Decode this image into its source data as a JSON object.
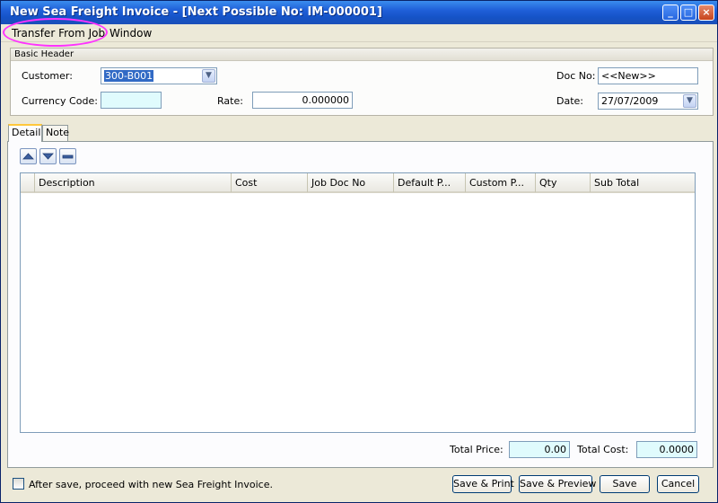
{
  "window": {
    "title": "New Sea Freight Invoice  - [Next Possible No: IM-000001]",
    "minimize": "_",
    "maximize": "□",
    "close": "×"
  },
  "menu": {
    "transfer_from_job": "Transfer From Job",
    "window": "Window"
  },
  "header": {
    "group_title": "Basic Header",
    "customer_label": "Customer:",
    "customer_value": "300-B001",
    "currency_label": "Currency Code:",
    "currency_value": "",
    "rate_label": "Rate:",
    "rate_value": "0.000000",
    "docno_label": "Doc No:",
    "docno_value": "<<New>>",
    "date_label": "Date:",
    "date_value": "27/07/2009"
  },
  "tabs": {
    "detail": "Detail",
    "note": "Note"
  },
  "grid": {
    "columns": [
      "",
      "Description",
      "Cost",
      "Job Doc No",
      "Default P...",
      "Custom P...",
      "Qty",
      "Sub Total"
    ]
  },
  "totals": {
    "total_price_label": "Total Price:",
    "total_price_value": "0.00",
    "total_cost_label": "Total Cost:",
    "total_cost_value": "0.0000"
  },
  "footer": {
    "checkbox_label": "After save, proceed with new Sea Freight Invoice.",
    "save_print": "Save & Print",
    "save_preview": "Save & Preview",
    "save": "Save",
    "cancel": "Cancel"
  },
  "colors": {
    "titlebar": "#1f5fd8",
    "highlight": "#ff33ff",
    "readonly_field": "#e0fbfd"
  }
}
